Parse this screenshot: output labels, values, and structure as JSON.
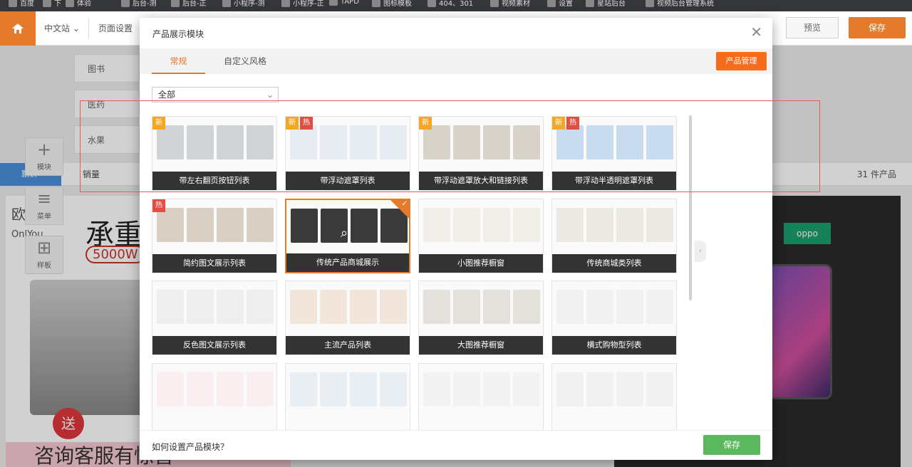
{
  "bookmarks": [
    "百度",
    "下",
    "体验",
    "后台-测",
    "后台-正",
    "小程序-测",
    "小程序-正",
    "TAPD",
    "图标模板",
    "404、301",
    "视频素材",
    "设置",
    "星站后台",
    "视频后台管理系统"
  ],
  "toolbar": {
    "site": "中文站",
    "page_settings": "页面设置",
    "preview": "预览",
    "save": "保存"
  },
  "background": {
    "categories": [
      "图书",
      "医药",
      "水果"
    ],
    "default_label": "默认",
    "sales_label": "销量",
    "count": "31 件产品",
    "tools": [
      {
        "label": "模块",
        "icon": "plus-icon"
      },
      {
        "label": "菜单",
        "icon": "menu-icon"
      },
      {
        "label": "样板",
        "icon": "layout-icon"
      }
    ],
    "promo": {
      "brand": "欧",
      "brand_en": "OnlYou",
      "headline": "承重",
      "power": "5000W",
      "gift": "送",
      "footer": "咨询客服有惊喜"
    },
    "phone_brand": "oppo"
  },
  "dialog": {
    "title": "产品展示模块",
    "tabs": [
      {
        "label": "常规",
        "active": true
      },
      {
        "label": "自定义风格",
        "active": false
      }
    ],
    "manage_button": "产品管理",
    "filter": {
      "value": "全部"
    },
    "cards": [
      {
        "label": "带左右翻页按钮列表",
        "badges": [
          "新"
        ]
      },
      {
        "label": "带浮动遮罩列表",
        "badges": [
          "新",
          "热"
        ]
      },
      {
        "label": "带浮动遮罩放大和链接列表",
        "badges": [
          "新"
        ]
      },
      {
        "label": "带浮动半透明遮罩列表",
        "badges": [
          "新",
          "热"
        ]
      },
      {
        "label": "简约图文展示列表",
        "badges": [
          "热"
        ]
      },
      {
        "label": "传统产品商城展示",
        "badges": [],
        "selected": true
      },
      {
        "label": "小图推荐橱窗",
        "badges": []
      },
      {
        "label": "传统商城类列表",
        "badges": []
      },
      {
        "label": "反色图文展示列表",
        "badges": []
      },
      {
        "label": "主流产品列表",
        "badges": []
      },
      {
        "label": "大图推荐橱窗",
        "badges": []
      },
      {
        "label": "横式购物型列表",
        "badges": []
      },
      {
        "label": "",
        "badges": []
      },
      {
        "label": "",
        "badges": []
      },
      {
        "label": "",
        "badges": []
      },
      {
        "label": "",
        "badges": []
      }
    ],
    "help_text": "如何设置产品模块？",
    "save_button": "保存"
  },
  "colors": {
    "accent": "#e57a2c",
    "manage": "#f56c1d",
    "save_green": "#5cb85c",
    "new_badge": "#f5a623",
    "hot_badge": "#e54d42"
  }
}
